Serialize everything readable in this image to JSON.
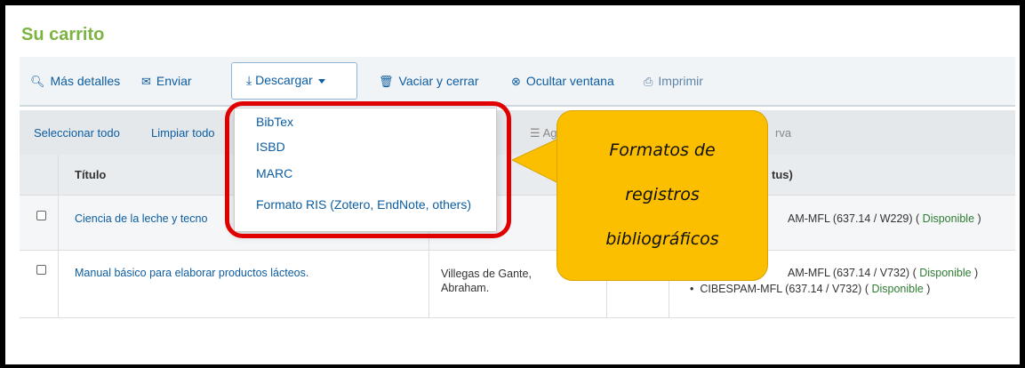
{
  "title": "Su carrito",
  "toolbar": {
    "mas_detalles": "Más detalles",
    "enviar": "Enviar",
    "descargar": "Descargar",
    "vaciar": "Vaciar y cerrar",
    "ocultar": "Ocultar ventana",
    "imprimir": "Imprimir"
  },
  "selection": {
    "select_all": "Seleccionar todo",
    "clear_all": "Limpiar todo",
    "add_partial": "Ag",
    "reserve_partial": "rva"
  },
  "table": {
    "headers": {
      "title": "Título",
      "location": "tus)"
    },
    "rows": [
      {
        "title": "Ciencia de la leche y tecno",
        "author": "",
        "location_items": [
          "AM-MFL (637.14 / W229)"
        ],
        "status": "Disponible"
      },
      {
        "title": "Manual básico para elaborar productos lácteos.",
        "author": "Villegas de Gante, Abraham.",
        "location_items": [
          "AM-MFL (637.14 / V732)",
          "CIBESPAM-MFL (637.14 / V732)"
        ],
        "status": "Disponible"
      }
    ]
  },
  "dropdown": {
    "items": [
      "BibTex",
      "ISBD",
      "MARC",
      "Formato RIS (Zotero, EndNote, others)"
    ]
  },
  "callout": {
    "lines": [
      "Formatos de",
      "registros",
      "bibliográficos"
    ]
  },
  "colors": {
    "title_green": "#7cb342",
    "link_blue": "#0d5da1",
    "callout_yellow": "#fbbf00",
    "highlight_red": "#e00000",
    "available_green": "#2e7d32"
  }
}
